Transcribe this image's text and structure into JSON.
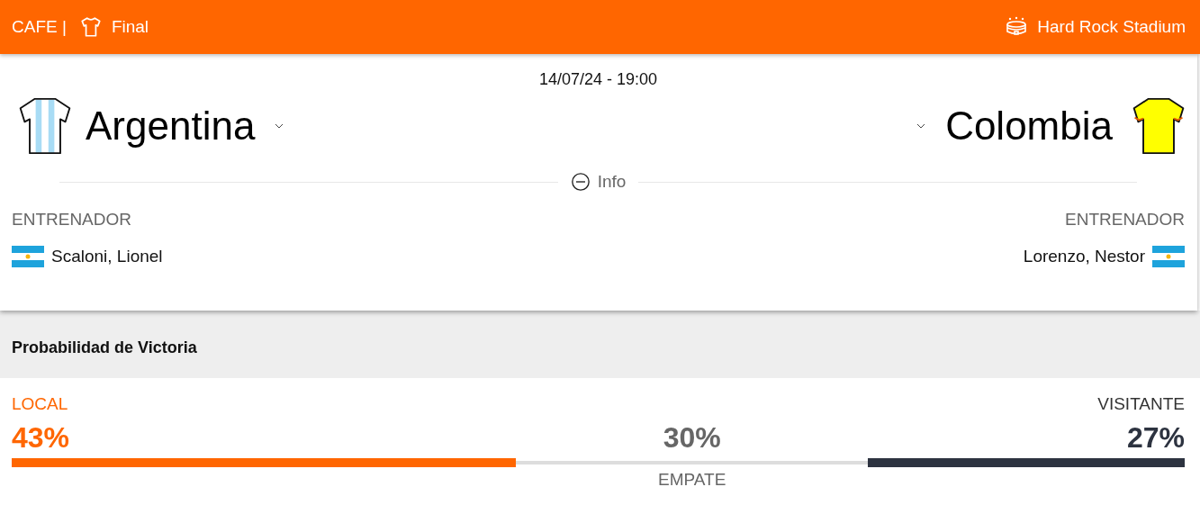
{
  "header": {
    "competition": "CAFE |",
    "round": "Final",
    "venue": "Hard Rock Stadium"
  },
  "match": {
    "datetime": "14/07/24 - 19:00",
    "teams": [
      {
        "kind": "striped",
        "name": "Argentina"
      },
      {
        "kind": "plain",
        "name": "Colombia"
      }
    ]
  },
  "info": {
    "label": "Info",
    "expanded": true
  },
  "coaches": [
    {
      "label": "ENTRENADOR",
      "name": "Scaloni, Lionel"
    },
    {
      "label": "ENTRENADOR",
      "name": "Lorenzo, Nestor"
    }
  ],
  "probability": {
    "title": "Probabilidad de Victoria",
    "segments": [
      {
        "kind": "home",
        "label": "LOCAL",
        "value": "43%"
      },
      {
        "kind": "draw",
        "label": "EMPATE",
        "value": "30%"
      },
      {
        "kind": "away",
        "label": "VISITANTE",
        "value": "27%"
      }
    ]
  }
}
